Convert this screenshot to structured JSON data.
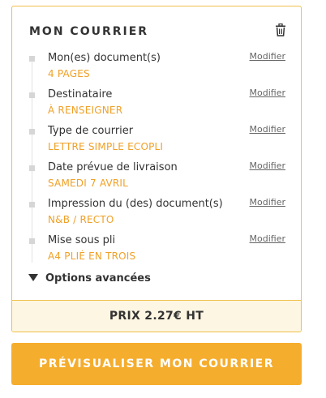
{
  "panel": {
    "title": "MON COURRIER",
    "delete_icon": "trash-icon",
    "steps": [
      {
        "label": "Mon(es) document(s)",
        "value": "4 PAGES",
        "link": "Modifier"
      },
      {
        "label": "Destinataire",
        "value": "À RENSEIGNER",
        "link": "Modifier"
      },
      {
        "label": "Type de courrier",
        "value": "LETTRE SIMPLE ECOPLI",
        "link": "Modifier"
      },
      {
        "label": "Date prévue de livraison",
        "value": "SAMEDI 7 AVRIL",
        "link": "Modifier"
      },
      {
        "label": "Impression du (des) document(s)",
        "value": "N&B / RECTO",
        "link": "Modifier"
      },
      {
        "label": "Mise sous pli",
        "value": "A4 PLIÉ EN TROIS",
        "link": "Modifier"
      }
    ],
    "advanced_options": "Options avancées",
    "advanced_icon": "triangle-down-icon",
    "price": "PRIX 2.27€ HT"
  },
  "actions": {
    "preview_label": "PRÉVISUALISER MON COURRIER"
  },
  "colors": {
    "accent": "#f5ad2e",
    "border": "#f0c04a",
    "value_text": "#f0a026",
    "price_background": "#fdf6e2"
  }
}
